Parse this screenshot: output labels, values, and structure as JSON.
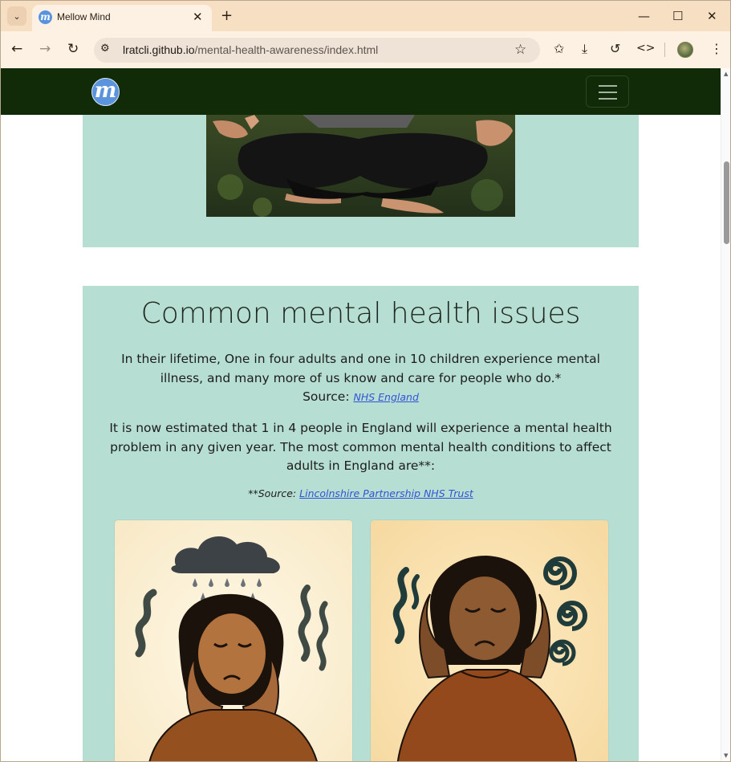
{
  "browser": {
    "tab_title": "Mellow Mind",
    "url_host": "lratcli.github.io",
    "url_path": "/mental-health-awareness/index.html"
  },
  "site": {
    "logo_letter": "m",
    "accent": "#5b93dd",
    "nav_bg": "#112b09",
    "section_bg": "#b7ded2"
  },
  "section": {
    "heading": "Common mental health issues",
    "para1": "In their lifetime, One in four adults and one in 10 children experience mental illness, and many more of us know and care for people who do.*",
    "source1_label": "Source:",
    "source1_link": "NHS England",
    "para2": "It is now estimated that 1 in 4 people in England will experience a mental health problem in any given year. The most common mental health conditions to affect adults in England are**:",
    "source2_label": "**Source:",
    "source2_link": "Lincolnshire Partnership NHS Trust"
  }
}
